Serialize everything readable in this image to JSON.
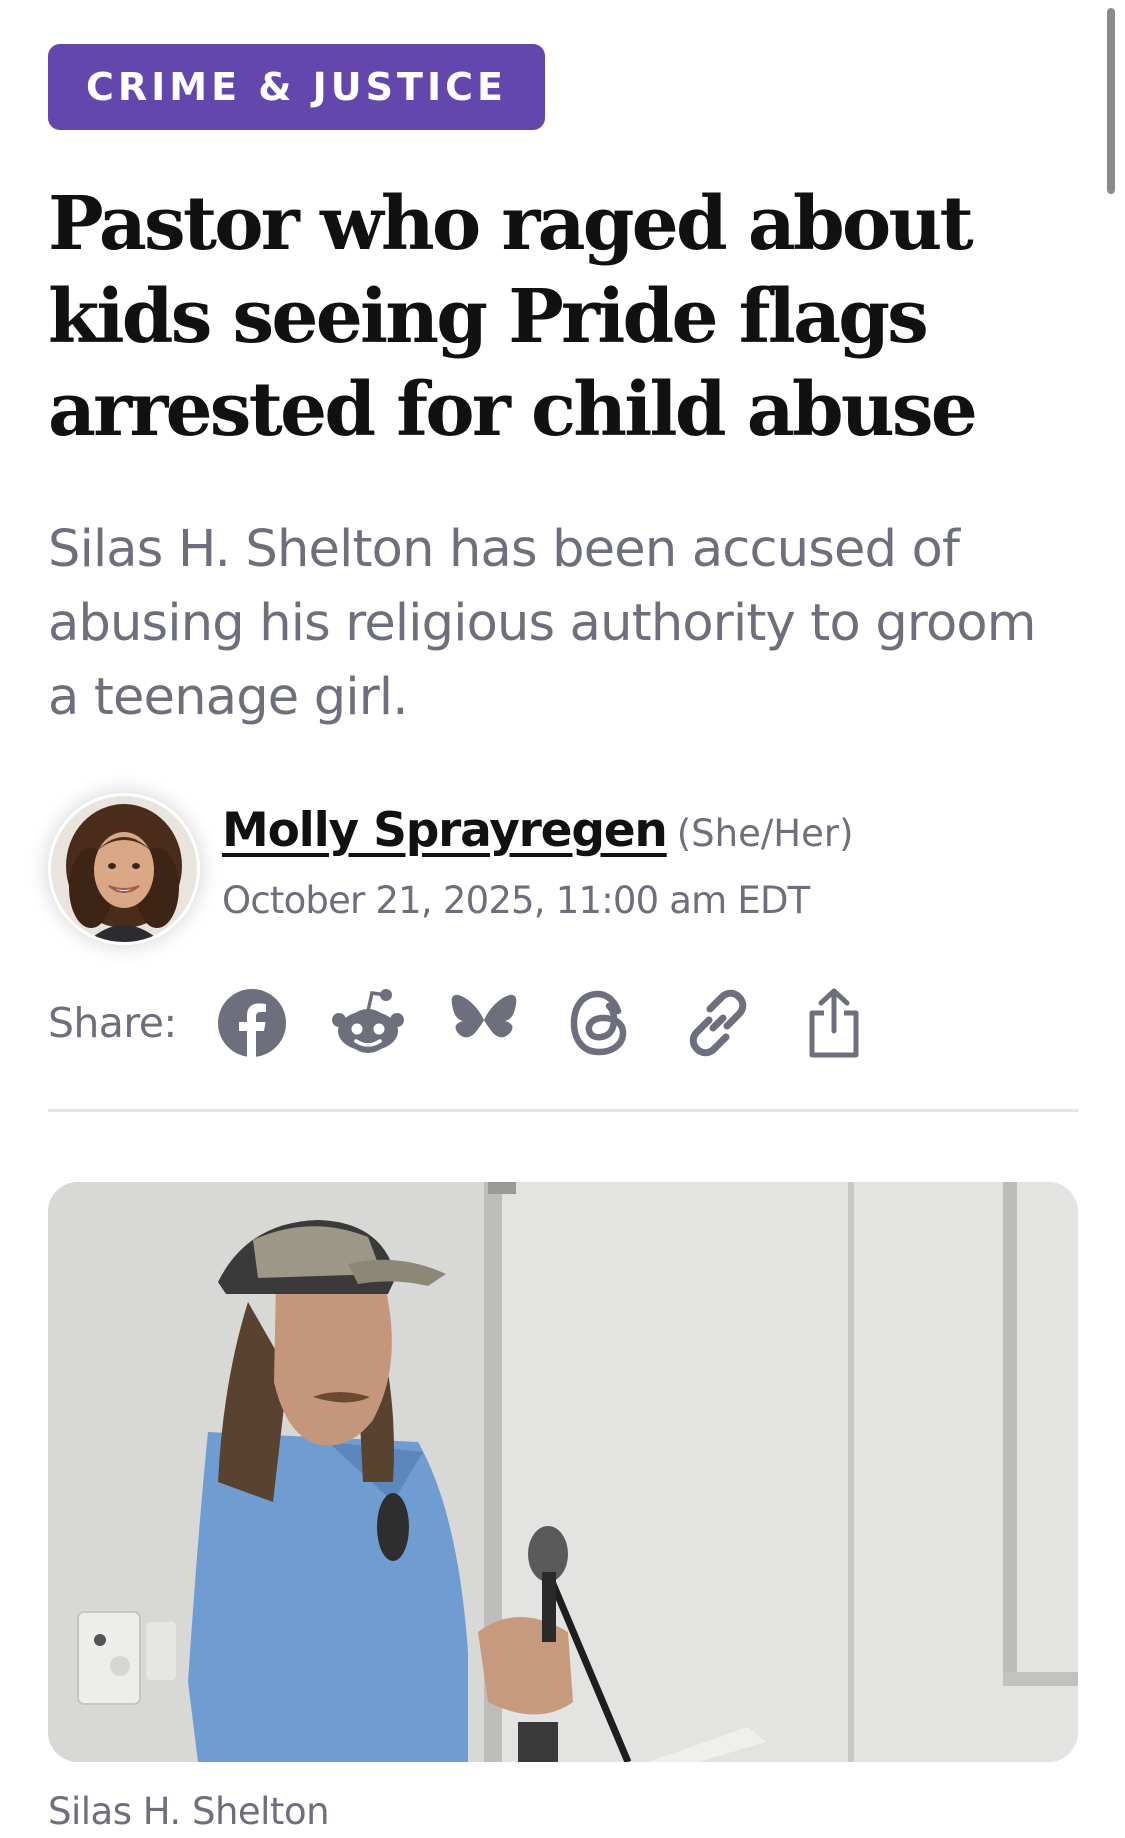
{
  "article": {
    "category": "CRIME & JUSTICE",
    "headline": "Pastor who raged about kids seeing Pride flags arrested for child abuse",
    "dek": "Silas H. Shelton has been accused of abusing his religious authority to groom a teenage girl.",
    "author": {
      "name": "Molly Sprayregen",
      "pronouns": "(She/Her)",
      "date": "October 21, 2025, 11:00 am EDT"
    },
    "share": {
      "label": "Share:",
      "icons": [
        "facebook-icon",
        "reddit-icon",
        "bluesky-icon",
        "threads-icon",
        "link-icon",
        "share-icon"
      ]
    },
    "image_caption": "Silas H. Shelton"
  },
  "colors": {
    "badge_bg": "#6447ad",
    "headline": "#111111",
    "dek": "#6e6f7c",
    "icon": "#6e6f7c"
  }
}
